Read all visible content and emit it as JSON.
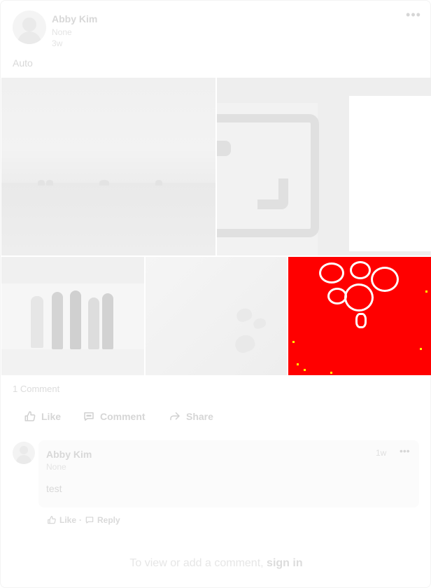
{
  "post": {
    "author_name": "Abby Kim",
    "author_subtitle": "None",
    "time_ago": "3w",
    "more_icon": "more-horizontal-icon",
    "text": "Auto"
  },
  "media": {
    "tiles": [
      {
        "description": "landscape-photo"
      },
      {
        "description": "image-placeholder-graphic"
      },
      {
        "description": "group-photo"
      },
      {
        "description": "butterfly-graphic"
      },
      {
        "description": "red-flower-photo"
      }
    ],
    "red_tile_color": "#ff0000"
  },
  "stats": {
    "comment_count": "1 Comment"
  },
  "actions": {
    "like_label": "Like",
    "comment_label": "Comment",
    "share_label": "Share",
    "like_icon": "thumbs-up-icon",
    "comment_icon": "speech-bubble-icon",
    "share_icon": "share-arrow-icon"
  },
  "comments": [
    {
      "author_name": "Abby Kim",
      "author_subtitle": "None",
      "text": "test",
      "time_ago": "1w",
      "like_label": "Like",
      "separator": "·",
      "reply_label": "Reply"
    }
  ],
  "footer": {
    "prompt_prefix": "To view or add a comment,",
    "sign_in_label": "sign in"
  }
}
